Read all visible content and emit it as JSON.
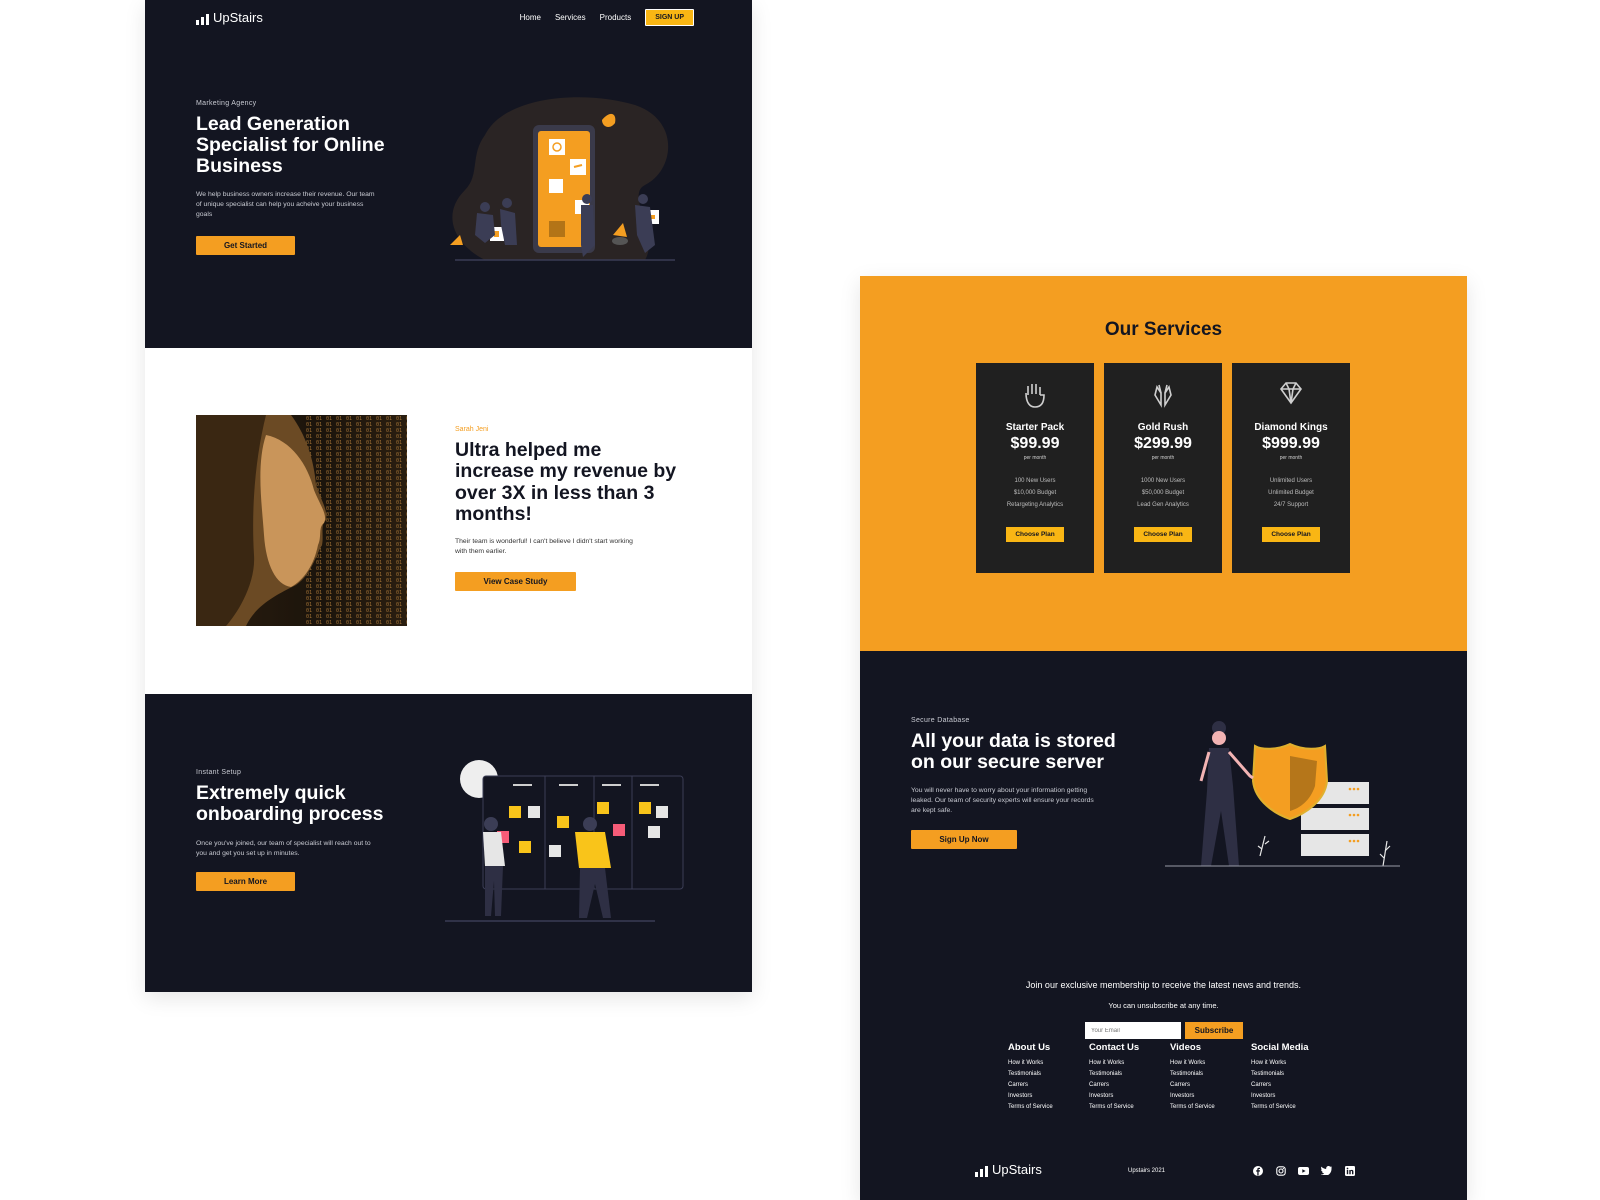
{
  "brand": {
    "name": "UpStairs",
    "accent": "#F49E21",
    "yellow": "#F9B614",
    "dark": "#131521"
  },
  "nav": {
    "items": [
      "Home",
      "Services",
      "Products"
    ],
    "signup": "SIGN UP"
  },
  "hero": {
    "eyebrow": "Marketing Agency",
    "title": "Lead Generation Specialist for Online Business",
    "body": "We help business owners increase their revenue. Our team of unique specialist can help you acheive your business goals",
    "cta": "Get Started"
  },
  "testimonial": {
    "name": "Sarah Jeni",
    "quote": "Ultra helped me increase my revenue by over 3X in less than 3 months!",
    "body": "Their team is wonderful! I can't believe I didn't start working with them earlier.",
    "cta": "View Case Study"
  },
  "onboarding": {
    "eyebrow": "Instant Setup",
    "title": "Extremely quick onboarding process",
    "body": "Once you've joined, our team of specialist will reach out to you and get you set up in minutes.",
    "cta": "Learn More"
  },
  "services": {
    "title": "Our Services",
    "plans": [
      {
        "icon": "hand-icon",
        "name": "Starter Pack",
        "price": "$99.99",
        "per": "per month",
        "features": [
          "100 New Users",
          "$10,000 Budget",
          "Retargeting Analytics"
        ],
        "cta": "Choose Plan"
      },
      {
        "icon": "hands-icon",
        "name": "Gold Rush",
        "price": "$299.99",
        "per": "per month",
        "features": [
          "1000 New Users",
          "$50,000 Budget",
          "Lead Gen Analytics"
        ],
        "cta": "Choose Plan"
      },
      {
        "icon": "diamond-icon",
        "name": "Diamond Kings",
        "price": "$999.99",
        "per": "per month",
        "features": [
          "Unlimited Users",
          "Unlimited Budget",
          "24/7 Support"
        ],
        "cta": "Choose Plan"
      }
    ]
  },
  "secure": {
    "eyebrow": "Secure Database",
    "title": "All your data is stored on our secure server",
    "body": "You will never have to worry about your information getting leaked. Our team of security experts will ensure your records are kept safe.",
    "cta": "Sign Up Now"
  },
  "newsletter": {
    "text": "Join our exclusive membership to receive the latest news and trends.",
    "sub": "You can unsubscribe at any time.",
    "placeholder": "Your Email",
    "button": "Subscribe"
  },
  "footer": {
    "columns": [
      {
        "title": "About Us",
        "links": [
          "How it Works",
          "Testimonials",
          "Carrers",
          "Investors",
          "Terms of Service"
        ]
      },
      {
        "title": "Contact Us",
        "links": [
          "How it Works",
          "Testimonials",
          "Carrers",
          "Investors",
          "Terms of Service"
        ]
      },
      {
        "title": "Videos",
        "links": [
          "How it Works",
          "Testimonials",
          "Carrers",
          "Investors",
          "Terms of Service"
        ]
      },
      {
        "title": "Social Media",
        "links": [
          "How it Works",
          "Testimonials",
          "Carrers",
          "Investors",
          "Terms of Service"
        ]
      }
    ],
    "copyright": "Upstairs 2021",
    "social": [
      "facebook-icon",
      "instagram-icon",
      "youtube-icon",
      "twitter-icon",
      "linkedin-icon"
    ]
  }
}
